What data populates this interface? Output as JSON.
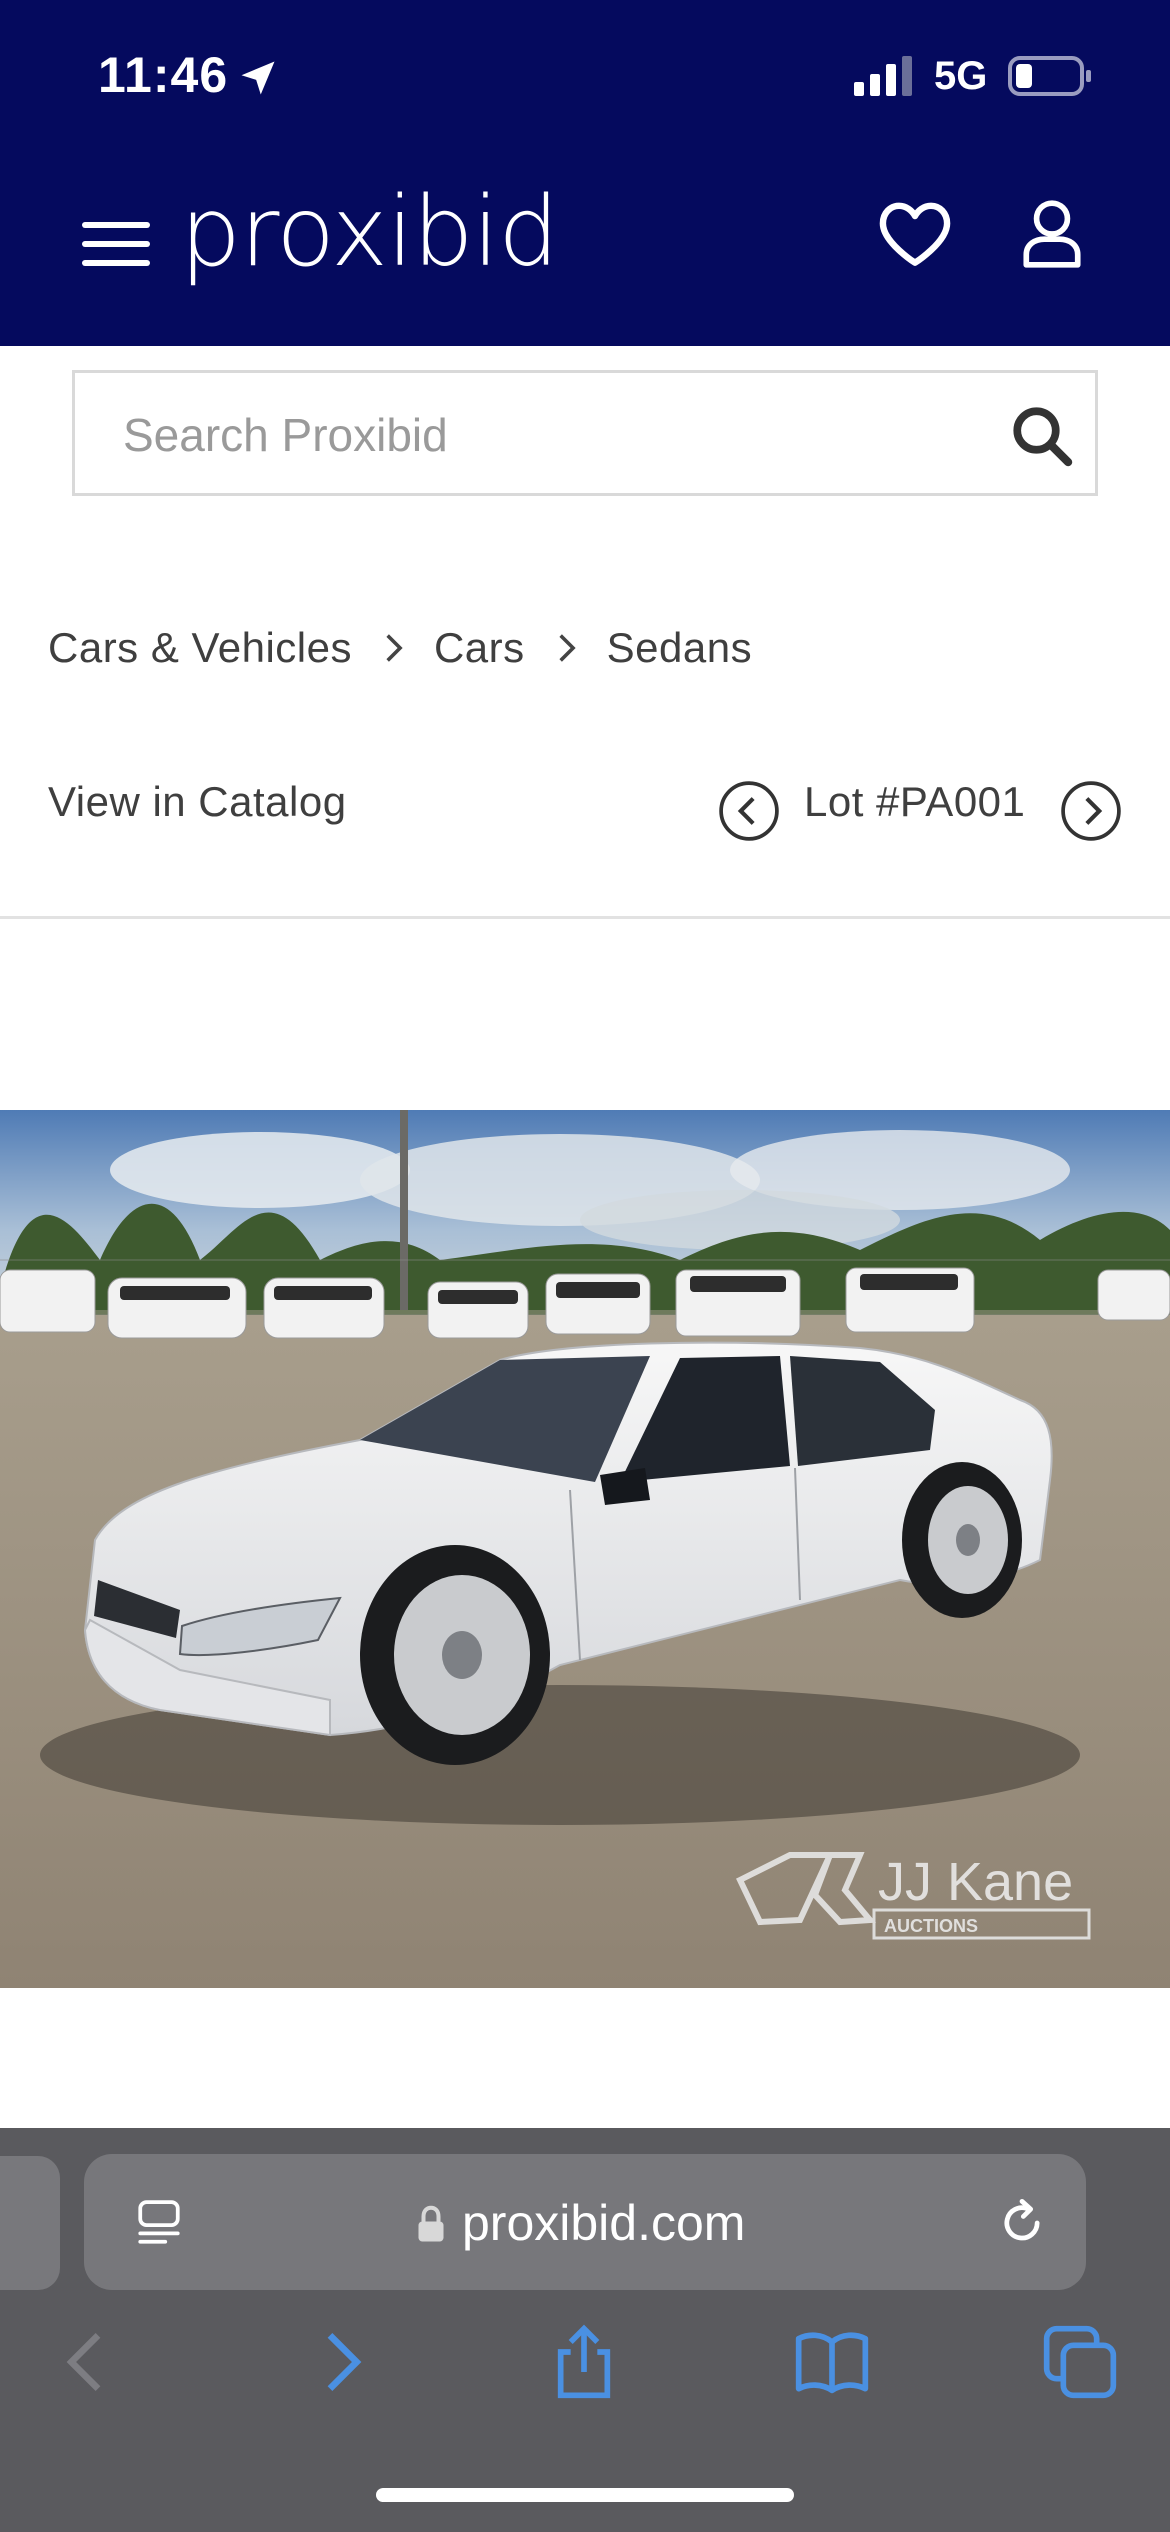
{
  "status_bar": {
    "time": "11:46",
    "network": "5G",
    "icons": [
      "location-arrow-icon",
      "signal-icon",
      "battery-icon"
    ]
  },
  "header": {
    "brand": "proxibid",
    "icons": [
      "menu-icon",
      "heart-icon",
      "user-icon"
    ]
  },
  "search": {
    "placeholder": "Search Proxibid",
    "value": ""
  },
  "breadcrumb": {
    "items": [
      "Cars & Vehicles",
      "Cars",
      "Sedans"
    ]
  },
  "catalog_nav": {
    "view_in_catalog": "View in Catalog",
    "lot": "Lot #PA001"
  },
  "lot_photo": {
    "watermark_text": "JJ Kane",
    "watermark_subtext": "AUCTIONS"
  },
  "browser": {
    "url": "proxibid.com"
  },
  "colors": {
    "header_bg": "#050a5e",
    "safari_bg": "#5a5a5e",
    "safari_accent": "#4a90e2"
  }
}
